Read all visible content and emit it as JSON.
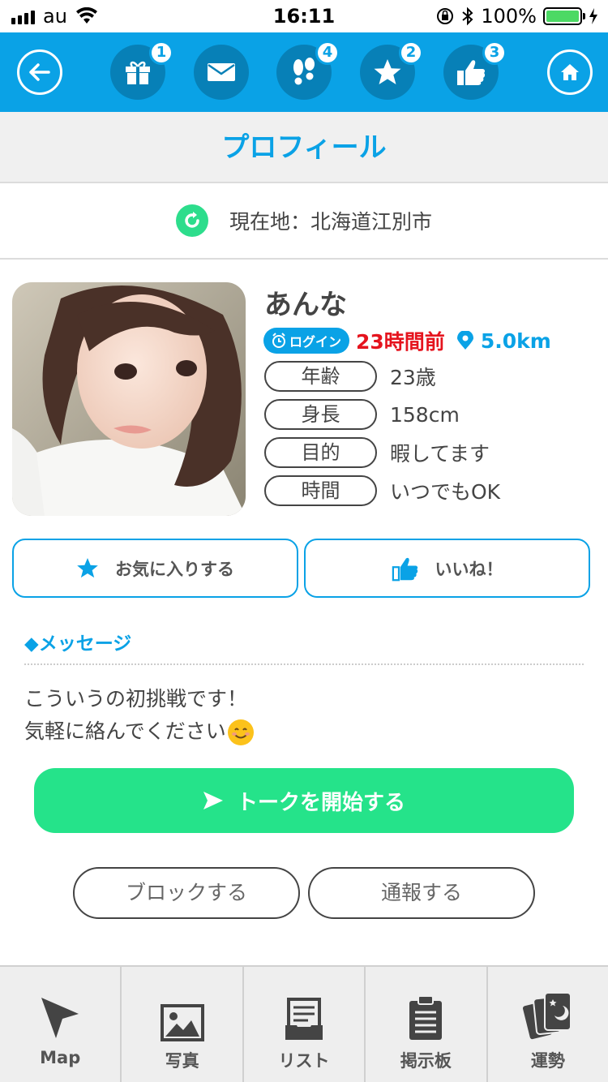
{
  "status_bar": {
    "carrier": "au",
    "time": "16:11",
    "battery": "100%"
  },
  "toolbar": {
    "badges": {
      "gift": "1",
      "footprints": "4",
      "favorites": "2",
      "likes": "3"
    }
  },
  "page_title": "プロフィール",
  "location": "現在地：北海道江別市",
  "profile": {
    "name": "あんな",
    "login_label": "ログイン",
    "last_login": "23時間前",
    "distance": "5.0km",
    "attributes": [
      {
        "key": "年齢",
        "value": "23歳"
      },
      {
        "key": "身長",
        "value": "158cm"
      },
      {
        "key": "目的",
        "value": "暇してます"
      },
      {
        "key": "時間",
        "value": "いつでもOK"
      }
    ]
  },
  "actions": {
    "favorite": "お気に入りする",
    "like": "いいね！"
  },
  "message": {
    "title": "◆メッセージ",
    "line1": "こういうの初挑戦です！",
    "line2": "気軽に絡んでください"
  },
  "talk_button": "トークを開始する",
  "block_button": "ブロックする",
  "report_button": "通報する",
  "tabs": [
    "Map",
    "写真",
    "リスト",
    "掲示板",
    "運勢"
  ],
  "colors": {
    "brand": "#0aa2e6",
    "green": "#25e38a",
    "red": "#e5141e"
  }
}
